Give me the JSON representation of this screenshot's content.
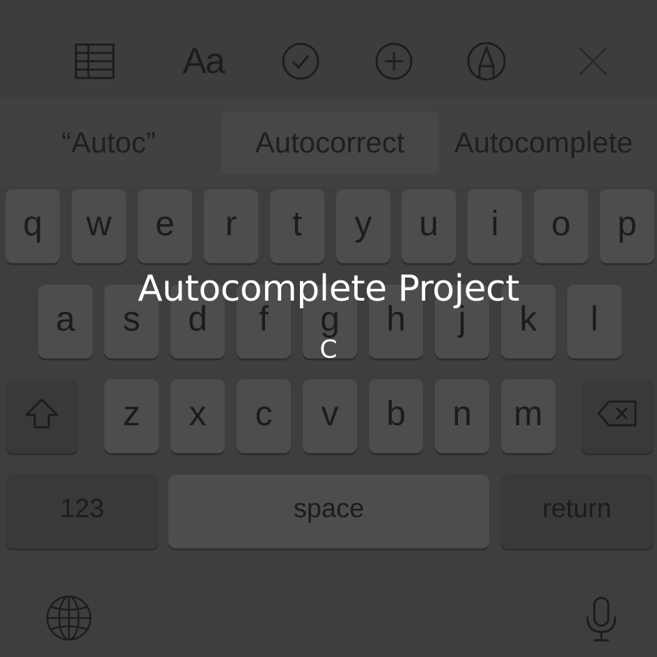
{
  "toolbar": {
    "table_icon": "table-icon",
    "format_label": "Aa",
    "checklist_icon": "checkmark-circle-icon",
    "add_icon": "plus-circle-icon",
    "markup_icon": "pen-circle-icon",
    "close_icon": "close-icon"
  },
  "suggestions": [
    "“Autoc”",
    "Autocorrect",
    "Autocomplete"
  ],
  "rows": {
    "row1": [
      "q",
      "w",
      "e",
      "r",
      "t",
      "y",
      "u",
      "i",
      "o",
      "p"
    ],
    "row2": [
      "a",
      "s",
      "d",
      "f",
      "g",
      "h",
      "j",
      "k",
      "l"
    ],
    "row3": [
      "z",
      "x",
      "c",
      "v",
      "b",
      "n",
      "m"
    ]
  },
  "keys": {
    "shift_icon": "shift-icon",
    "delete_icon": "delete-icon",
    "numbers_label": "123",
    "space_label": "space",
    "return_label": "return",
    "globe_icon": "globe-icon",
    "mic_icon": "microphone-icon"
  },
  "overlay": {
    "title": "Autocomplete Project",
    "subtitle": "C"
  }
}
